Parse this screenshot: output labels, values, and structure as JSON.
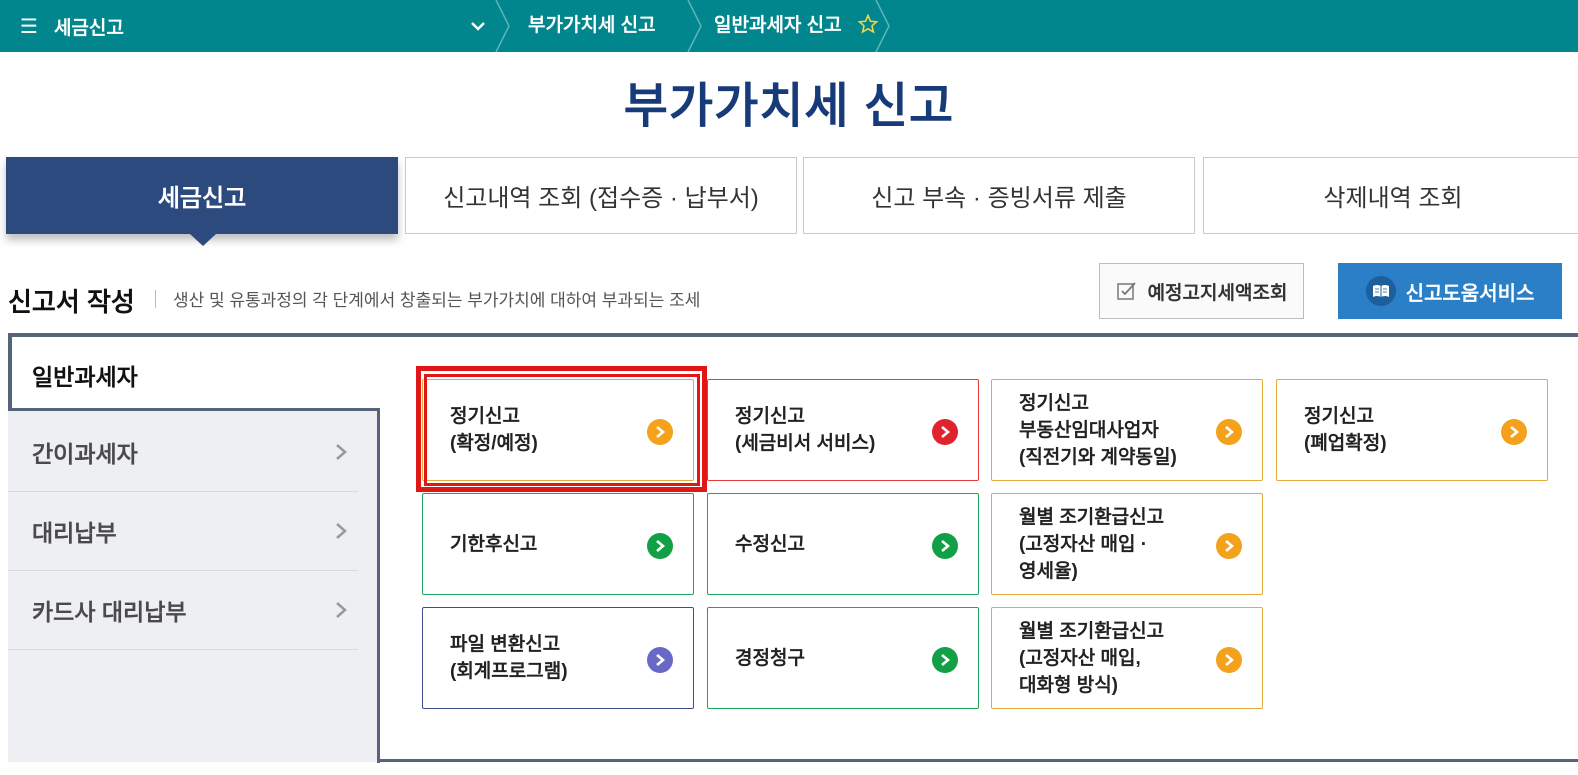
{
  "topbar": {
    "menu_label": "세금신고",
    "crumbs": [
      "부가가치세 신고",
      "일반과세자 신고"
    ]
  },
  "page_title": "부가가치세 신고",
  "tabs": [
    {
      "label": "세금신고",
      "active": true
    },
    {
      "label": "신고내역 조회 (접수증 · 납부서)",
      "active": false
    },
    {
      "label": "신고 부속 · 증빙서류 제출",
      "active": false
    },
    {
      "label": "삭제내역 조회",
      "active": false
    }
  ],
  "section": {
    "title": "신고서 작성",
    "description": "생산 및 유통과정의 각 단계에서 창출되는 부가가치에 대하여 부과되는 조세"
  },
  "buttons": {
    "notice_label": "예정고지세액조회",
    "help_label": "신고도움서비스"
  },
  "sidebar": {
    "active": "일반과세자",
    "items": [
      "간이과세자",
      "대리납부",
      "카드사 대리납부"
    ]
  },
  "cards": [
    {
      "lines": [
        "정기신고",
        "(확정/예정)"
      ],
      "color": "#f4a11b"
    },
    {
      "lines": [
        "정기신고",
        "(세금비서 서비스)"
      ],
      "color": "#e0242b"
    },
    {
      "lines": [
        "정기신고",
        "부동산임대사업자",
        "(직전기와 계약동일)"
      ],
      "color": "#f4a11b"
    },
    {
      "lines": [
        "정기신고",
        "(폐업확정)"
      ],
      "color": "#f4a11b"
    },
    {
      "lines": [
        "기한후신고"
      ],
      "color": "#12a047"
    },
    {
      "lines": [
        "수정신고"
      ],
      "color": "#12a047"
    },
    {
      "lines": [
        "월별 조기환급신고",
        "(고정자산 매입 ·",
        "영세율)"
      ],
      "color": "#f4a11b"
    },
    {
      "lines": [
        "파일 변환신고",
        "(회계프로그램)"
      ],
      "color": "#6a68c6"
    },
    {
      "lines": [
        "경정청구"
      ],
      "color": "#12a047"
    },
    {
      "lines": [
        "월별 조기환급신고",
        "(고정자산 매입,",
        "대화형 방식)"
      ],
      "color": "#f4a11b"
    }
  ],
  "colors": {
    "topbar": "#00868c",
    "title": "#163b78",
    "active_tab": "#2c4a7d",
    "help_button": "#2b7fc6",
    "highlight": "#e01717"
  }
}
